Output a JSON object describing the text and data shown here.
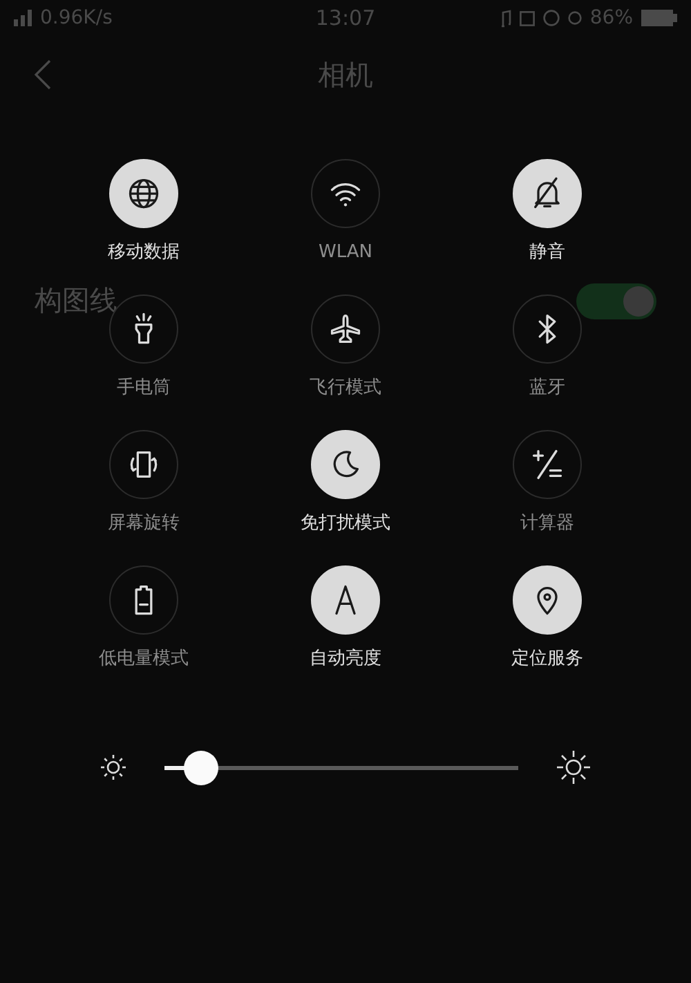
{
  "status_bar": {
    "speed": "0.96K/s",
    "time": "13:07",
    "battery": "86%"
  },
  "header": {
    "title": "相机"
  },
  "settings_rows": [
    {
      "label": "构图线",
      "on": true
    }
  ],
  "toggles": [
    {
      "label": "移动数据",
      "on": true
    },
    {
      "label": "WLAN",
      "on": false
    },
    {
      "label": "静音",
      "on": true
    },
    {
      "label": "手电筒",
      "on": false
    },
    {
      "label": "飞行模式",
      "on": false
    },
    {
      "label": "蓝牙",
      "on": false
    },
    {
      "label": "屏幕旋转",
      "on": false
    },
    {
      "label": "免打扰模式",
      "on": true
    },
    {
      "label": "计算器",
      "on": false
    },
    {
      "label": "低电量模式",
      "on": false
    },
    {
      "label": "自动亮度",
      "on": true
    },
    {
      "label": "定位服务",
      "on": true
    }
  ],
  "brightness": {
    "level": 0.1
  }
}
